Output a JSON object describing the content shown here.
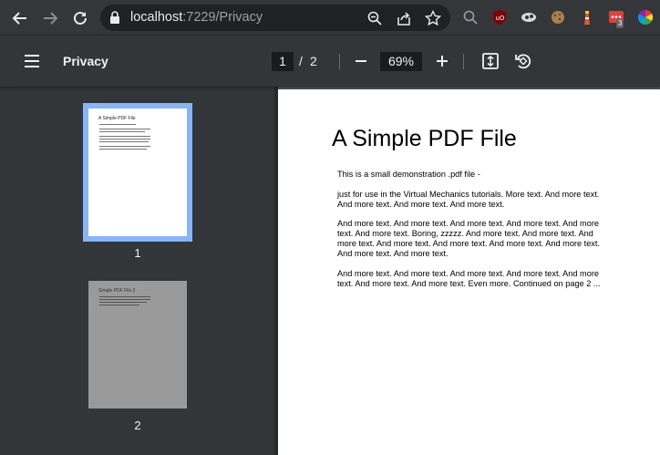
{
  "browser": {
    "url_host": "localhost",
    "url_rest": ":7229/Privacy",
    "extension_badge": "3"
  },
  "toolbar": {
    "title": "Privacy",
    "current_page": "1",
    "page_separator": "/",
    "total_pages": "2",
    "zoom": "69%"
  },
  "sidebar": {
    "thumbnails": [
      {
        "number": "1",
        "title": "A Simple PDF File",
        "selected": true
      },
      {
        "number": "2",
        "title": "Simple PDF File 2",
        "selected": false
      }
    ]
  },
  "page": {
    "heading": "A Simple PDF File",
    "paragraphs": [
      "This is a small demonstration .pdf file -",
      "just for use in the Virtual Mechanics tutorials. More text. And more text. And more text. And more text. And more text.",
      "And more text. And more text. And more text. And more text. And more text. And more text. Boring, zzzzz. And more text. And more text. And more text. And more text. And more text. And more text. And more text. And more text. And more text.",
      "And more text. And more text. And more text. And more text. And more text. And more text. And more text. Even more. Continued on page 2 ..."
    ]
  },
  "colors": {
    "browser_bg": "#35363a",
    "toolbar_bg": "#323639",
    "selected_thumb_border": "#8ab4f8"
  }
}
